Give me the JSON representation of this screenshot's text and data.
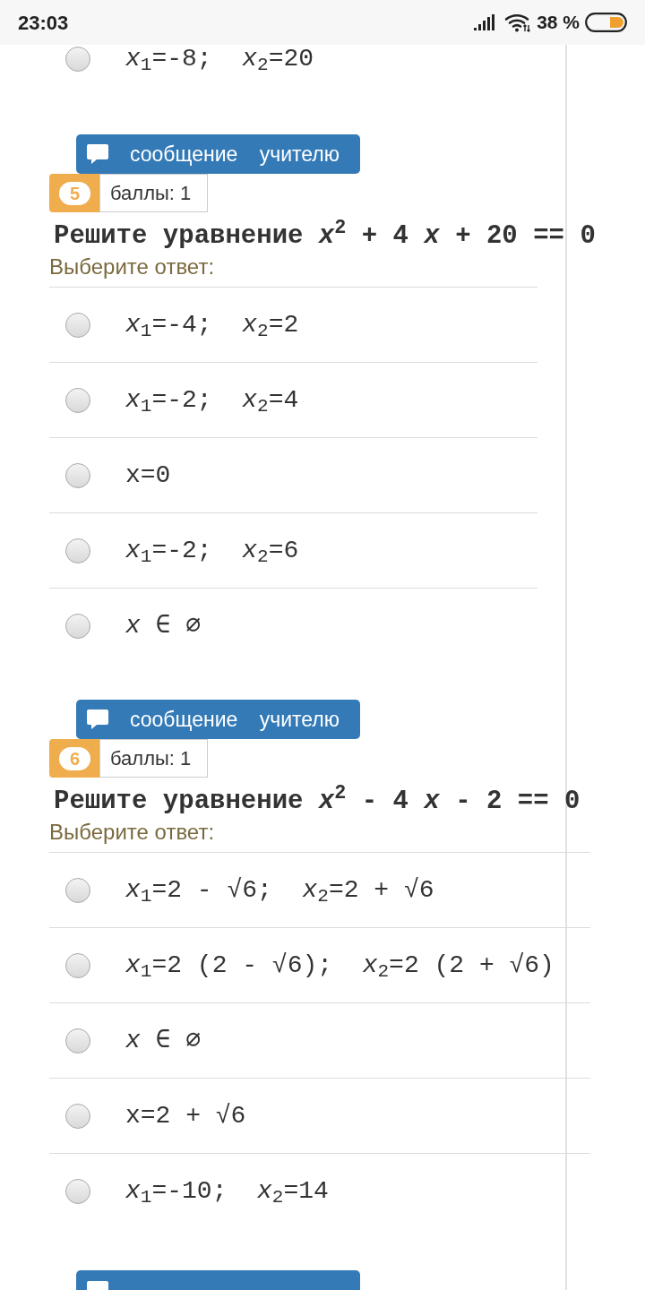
{
  "status_bar": {
    "time": "23:03",
    "battery": "38 %"
  },
  "previous_options": [
    {
      "text": "*x*$_{1}$=-8;  *x*$_{2}$=20",
      "selected": false
    }
  ],
  "questions": [
    {
      "message_button": "сообщение учителю",
      "number": "5",
      "points": "баллы: 1",
      "prompt": "Решите уравнение *x*$^{2}$ + 4 *x* + 20 == 0",
      "answer_label": "Выберите ответ:",
      "options": [
        {
          "text": "*x*$_{1}$=-4;  *x*$_{2}$=2",
          "selected": false
        },
        {
          "text": "*x*$_{1}$=-2;  *x*$_{2}$=4",
          "selected": false
        },
        {
          "text": "x=0",
          "selected": false
        },
        {
          "text": "*x*$_{1}$=-2;  *x*$_{2}$=6",
          "selected": false
        },
        {
          "text": "*x* ∈ ∅",
          "selected": false
        }
      ]
    },
    {
      "message_button": "сообщение учителю",
      "number": "6",
      "points": "баллы: 1",
      "prompt": "Решите уравнение *x*$^{2}$ - 4 *x* - 2 == 0",
      "answer_label": "Выберите ответ:",
      "options": [
        {
          "text": "*x*$_{1}$=2 - √6;  *x*$_{2}$=2 + √6",
          "selected": false
        },
        {
          "text": "*x*$_{1}$=2 (2 - √6);  *x*$_{2}$=2 (2 + √6)",
          "selected": false
        },
        {
          "text": "*x* ∈ ∅",
          "selected": false
        },
        {
          "text": "x=2 + √6",
          "selected": false
        },
        {
          "text": "*x*$_{1}$=-10;  *x*$_{2}$=14",
          "selected": false
        }
      ]
    }
  ],
  "next_question": {
    "message_button_shown": true
  }
}
